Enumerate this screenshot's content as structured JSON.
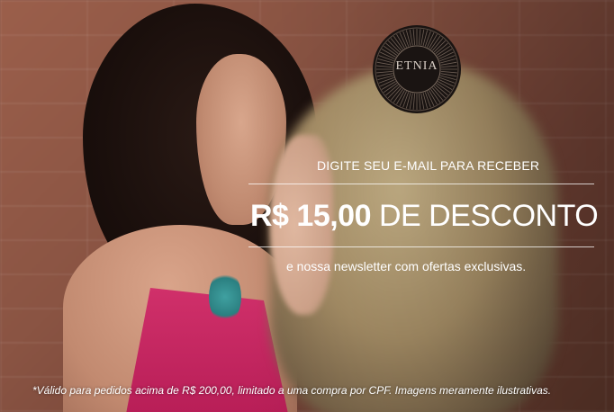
{
  "logo": {
    "text": "ETNIA"
  },
  "promo": {
    "line1": "DIGITE SEU E-MAIL PARA RECEBER",
    "headline_amount": "R$ 15,00",
    "headline_rest": " DE DESCONTO",
    "line3": "e nossa newsletter com ofertas exclusivas."
  },
  "disclaimer": "*Válido para pedidos acima de R$ 200,00, limitado a uma compra por CPF. Imagens meramente ilustrativas.",
  "colors": {
    "text": "#ffffff",
    "top_accent": "#c42460",
    "logo_bg": "#1a1412"
  }
}
